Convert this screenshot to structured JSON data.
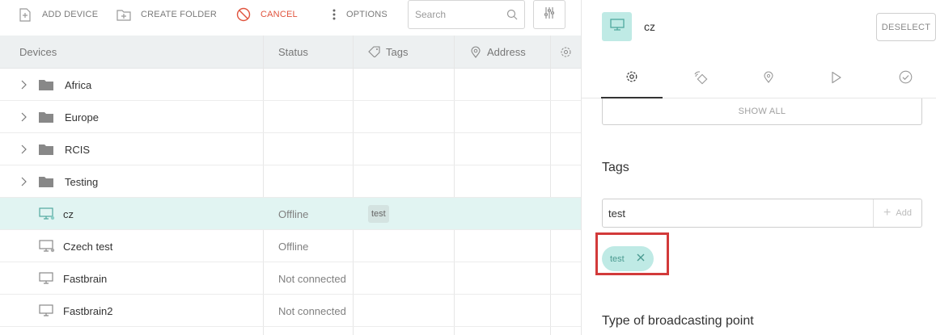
{
  "toolbar": {
    "add_device": "ADD DEVICE",
    "create_folder": "CREATE FOLDER",
    "cancel": "CANCEL",
    "options": "OPTIONS",
    "search_placeholder": "Search"
  },
  "table": {
    "headers": {
      "devices": "Devices",
      "status": "Status",
      "tags": "Tags",
      "address": "Address"
    },
    "folders": [
      {
        "name": "Africa"
      },
      {
        "name": "Europe"
      },
      {
        "name": "RCIS"
      },
      {
        "name": "Testing"
      }
    ],
    "devices": [
      {
        "name": "cz",
        "status": "Offline",
        "tag": "test",
        "selected": true
      },
      {
        "name": "Czech test",
        "status": "Offline",
        "tag": ""
      },
      {
        "name": "Fastbrain",
        "status": "Not connected",
        "tag": ""
      },
      {
        "name": "Fastbrain2",
        "status": "Not connected",
        "tag": ""
      }
    ]
  },
  "detail": {
    "device_name": "cz",
    "deselect": "DESELECT",
    "tabs": [
      "settings-tab",
      "broadcast-tab",
      "location-tab",
      "playback-tab",
      "check-tab"
    ],
    "show_all": "SHOW ALL",
    "tags_title": "Tags",
    "tag_input_value": "test",
    "add_label": "Add",
    "tag_pills": [
      "test"
    ],
    "broadcast_title": "Type of broadcasting point"
  },
  "colors": {
    "accent": "#bfeae5",
    "selected_row": "#e1f4f2",
    "cancel": "#e0533d",
    "highlight": "#d23a3a"
  }
}
